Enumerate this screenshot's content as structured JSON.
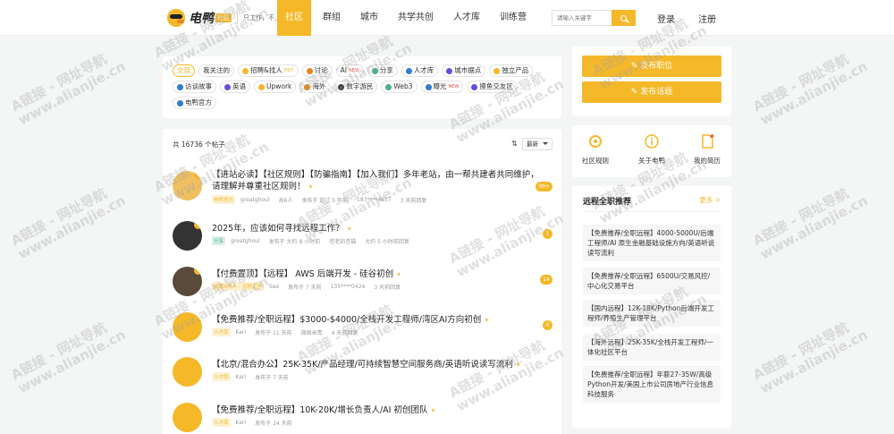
{
  "header": {
    "logo_name": "电鸭",
    "logo_tag": "社区",
    "slogan": "只工作，不上班",
    "nav": [
      "社区",
      "群组",
      "城市",
      "共学共创",
      "人才库",
      "训练营"
    ],
    "search_placeholder": "请输入关键字",
    "login": "登录",
    "register": "注册",
    "accent_color": "#f5b829"
  },
  "tags": {
    "row1": [
      {
        "label": "全部",
        "active": true
      },
      {
        "label": "我关注的"
      },
      {
        "label": "招聘&找人",
        "icon": "person-icon",
        "hot": "HOT"
      },
      {
        "label": "讨论",
        "icon": "chat-icon"
      },
      {
        "label": "AI",
        "new": "NEW"
      },
      {
        "label": "分享",
        "icon": "share-icon"
      },
      {
        "label": "人才库",
        "icon": "talent-icon"
      },
      {
        "label": "城市据点",
        "icon": "city-icon"
      },
      {
        "label": "独立产品",
        "icon": "product-icon"
      }
    ],
    "row2": [
      {
        "label": "访谈故事",
        "icon": "interview-icon"
      },
      {
        "label": "英语",
        "icon": "english-icon"
      },
      {
        "label": "Upwork",
        "icon": "upwork-icon"
      },
      {
        "label": "海外",
        "icon": "overseas-icon"
      },
      {
        "label": "数字游民",
        "icon": "nomad-icon"
      },
      {
        "label": "Web3",
        "icon": "web3-icon"
      },
      {
        "label": "曝光",
        "icon": "expose-icon",
        "new": "NEW"
      },
      {
        "label": "摸鱼交友区",
        "icon": "social-icon"
      }
    ],
    "row3": [
      {
        "label": "电鸭官方",
        "icon": "duck-icon"
      }
    ]
  },
  "feed": {
    "total": "共 16736 个帖子",
    "sort": "最新",
    "posts": [
      {
        "title": "【进站必读】【社区规则】【防骗指南】【加入我们】多年老站，由一帮共建者共同维护，请理解并尊重社区规则！",
        "tag": "电鸭官方",
        "tag_color": "#f5b829",
        "author": "greatghoul",
        "extra": "共6人",
        "time": "发布于 超过 5 年前",
        "phone": "187****4657",
        "reply": "3 天前回复",
        "count": "99+"
      },
      {
        "title": "2025年，应该如何寻找远程工作？",
        "tag": "分享",
        "tag_color": "#4caf8f",
        "author": "greatghoul",
        "time": "发布于 大约 8 小时前",
        "phone": "苍老的苍猫",
        "reply": "大约 5 小时前回复",
        "count": "1"
      },
      {
        "title": "【付费置顶】【远程】 AWS 后端开发 - 硅谷初创",
        "tag": "招聘&找人 - 远程工作",
        "tag_color": "#f5b829",
        "author": "Sea",
        "time": "发布于 7 天前",
        "phone": "135****0424",
        "reply": "3 天前回复",
        "count": "14"
      },
      {
        "title": "【免费推荐/全职远程】$3000-$4000/全栈开发工程师/湾区AI方向初创",
        "tag": "人才库",
        "tag_color": "#f5b829",
        "author": "Kari",
        "time": "发布于 11 天前",
        "phone": "微微米青",
        "reply": "4 天前回复",
        "count": "6"
      },
      {
        "title": "【北京/混合办公】25K-35K/产品经理/可持续智慧空间服务商/英语听说读写流利",
        "tag": "人才库",
        "tag_color": "#f5b829",
        "author": "Kari",
        "time": "发布于 7 天前",
        "phone": "",
        "reply": "",
        "count": ""
      },
      {
        "title": "【免费推荐/全职远程】10K-20K/增长负责人/AI 初创团队",
        "tag": "人才库",
        "tag_color": "#f5b829",
        "author": "Kari",
        "time": "发布于 14 天前",
        "phone": "",
        "reply": "",
        "count": ""
      }
    ]
  },
  "sidebar": {
    "publish_job": "发布职位",
    "publish_topic": "发布话题",
    "quick": [
      "社区规则",
      "关于电鸭",
      "我的简历"
    ],
    "remote_title": "远程全职推荐",
    "remote_more": "更多 >",
    "remote_items": [
      "【免费推荐/全职远程】4000-5000U/后端工程师/AI 原生金融基础设施方向/英语听说读写流利",
      "【免费推荐/全职远程】6500U/交易风控/中心化交易平台",
      "【国内远程】12K-18K/Python后端开发工程师/养殖生产管理平台",
      "【海外远程】25K-35K/全栈开发工程师/一体化社区平台",
      "【免费推荐/全职远程】年薪27-35W/高级Python开发/美国上市公司房地产行业信息科技服务"
    ]
  },
  "watermark": {
    "line1": "A链接 - 网址导航",
    "line2": "www.alianjie.cn"
  }
}
